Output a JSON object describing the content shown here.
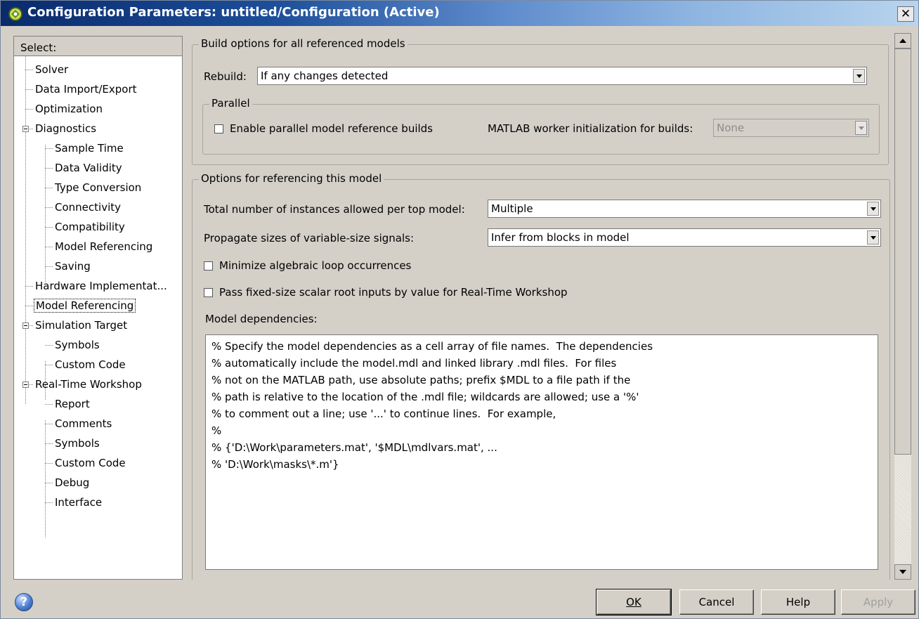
{
  "window": {
    "title": "Configuration Parameters: untitled/Configuration (Active)"
  },
  "tree": {
    "header": "Select:",
    "items": [
      {
        "label": "Solver"
      },
      {
        "label": "Data Import/Export"
      },
      {
        "label": "Optimization"
      },
      {
        "label": "Diagnostics"
      },
      {
        "label": "Sample Time"
      },
      {
        "label": "Data Validity"
      },
      {
        "label": "Type Conversion"
      },
      {
        "label": "Connectivity"
      },
      {
        "label": "Compatibility"
      },
      {
        "label": "Model Referencing"
      },
      {
        "label": "Saving"
      },
      {
        "label": "Hardware Implementat..."
      },
      {
        "label": "Model Referencing"
      },
      {
        "label": "Simulation Target"
      },
      {
        "label": "Symbols"
      },
      {
        "label": "Custom Code"
      },
      {
        "label": "Real-Time Workshop"
      },
      {
        "label": "Report"
      },
      {
        "label": "Comments"
      },
      {
        "label": "Symbols"
      },
      {
        "label": "Custom Code"
      },
      {
        "label": "Debug"
      },
      {
        "label": "Interface"
      }
    ]
  },
  "build": {
    "title": "Build options for all referenced models",
    "rebuild_label": "Rebuild:",
    "rebuild_value": "If any changes detected",
    "parallel": {
      "title": "Parallel",
      "enable_label": "Enable parallel model reference builds",
      "worker_label": "MATLAB worker initialization for builds:",
      "worker_value": "None"
    }
  },
  "options": {
    "title": "Options for referencing this model",
    "instances_label": "Total number of instances allowed per top model:",
    "instances_value": "Multiple",
    "propagate_label": "Propagate sizes of variable-size signals:",
    "propagate_value": "Infer from blocks in model",
    "minimize_label": "Minimize algebraic loop occurrences",
    "pass_label": "Pass fixed-size scalar root inputs by value for Real-Time Workshop",
    "deps_label": "Model dependencies:",
    "deps_text": "% Specify the model dependencies as a cell array of file names.  The dependencies\n% automatically include the model.mdl and linked library .mdl files.  For files\n% not on the MATLAB path, use absolute paths; prefix $MDL to a file path if the\n% path is relative to the location of the .mdl file; wildcards are allowed; use a '%'\n% to comment out a line; use '...' to continue lines.  For example,\n%\n% {'D:\\Work\\parameters.mat', '$MDL\\mdlvars.mat', ...\n% 'D:\\Work\\masks\\*.m'}"
  },
  "buttons": {
    "ok": "OK",
    "cancel": "Cancel",
    "help": "Help",
    "apply": "Apply"
  },
  "icons": {
    "app": "matlab-config-icon",
    "help": "help-icon"
  }
}
